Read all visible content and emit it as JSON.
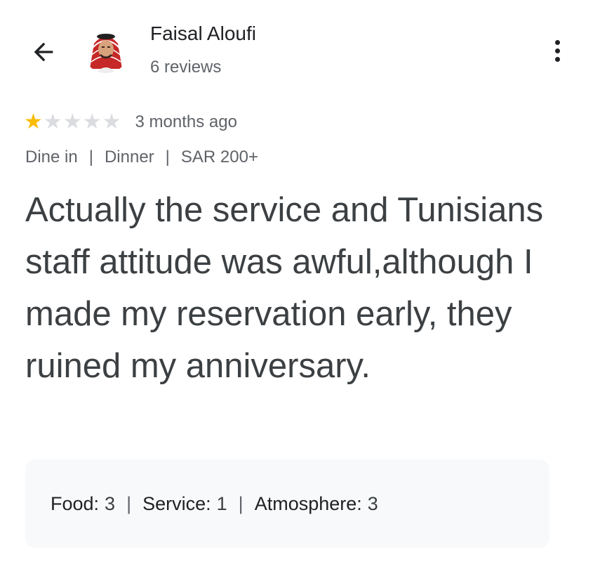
{
  "header": {
    "reviewer_name": "Faisal Aloufi",
    "reviews_count": "6 reviews",
    "back_icon": "arrow-left-icon",
    "more_icon": "more-vert-icon"
  },
  "review": {
    "rating": 1,
    "max_rating": 5,
    "time_ago": "3 months ago",
    "tags": [
      "Dine in",
      "Dinner",
      "SAR 200+"
    ],
    "text": "Actually the service and Tunisians staff attitude was awful,although I made my reservation early, they ruined my anniversary."
  },
  "sub_ratings": [
    {
      "label": "Food:",
      "value": "3"
    },
    {
      "label": "Service:",
      "value": "1"
    },
    {
      "label": "Atmosphere:",
      "value": "3"
    }
  ],
  "colors": {
    "star_filled": "#fbbc04",
    "star_empty": "#dadce0",
    "box_bg": "#f8f9fa"
  }
}
